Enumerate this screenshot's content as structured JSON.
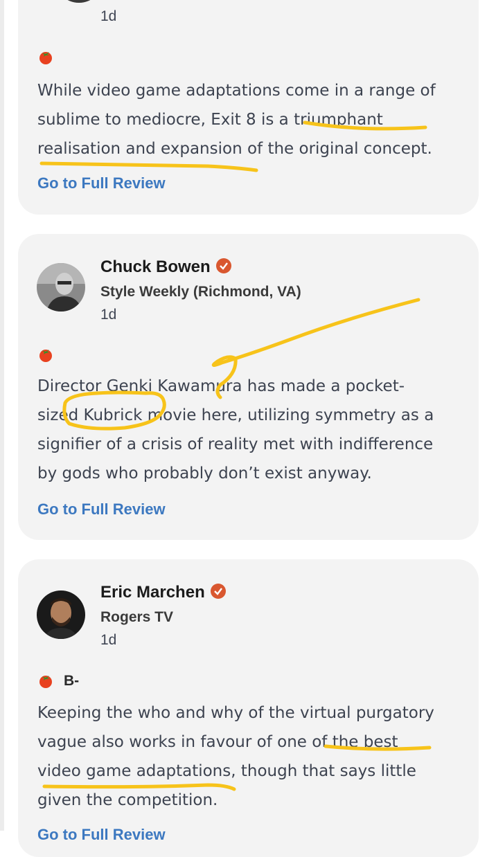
{
  "reviews": [
    {
      "time": "1d",
      "quote_lines": [
        "While video game adaptations come in a range of",
        "sublime to mediocre, Exit 8 is a triumphant",
        "realisation and expansion of the original concept."
      ],
      "link": "Go to Full Review"
    },
    {
      "critic": "Chuck Bowen",
      "publication": "Style Weekly (Richmond, VA)",
      "time": "1d",
      "quote_lines": [
        "Director Genki Kawamura has made a pocket-",
        "sized Kubrick movie here, utilizing symmetry as a",
        "signifier of a crisis of reality met with indifference",
        "by gods who probably don’t exist anyway."
      ],
      "link": "Go to Full Review"
    },
    {
      "critic": "Eric Marchen",
      "publication": "Rogers TV",
      "time": "1d",
      "grade": "B-",
      "quote_lines": [
        "Keeping the who and why of the virtual purgatory",
        "vague also works in favour of one of the best",
        "video game adaptations, though that says little",
        "given the competition."
      ],
      "link": "Go to Full Review"
    }
  ],
  "colors": {
    "card_bg": "#f3f3f3",
    "link": "#3c78c0",
    "verified_badge": "#d9572f",
    "tomato": "#e8411f",
    "highlighter": "#f7c31a"
  }
}
